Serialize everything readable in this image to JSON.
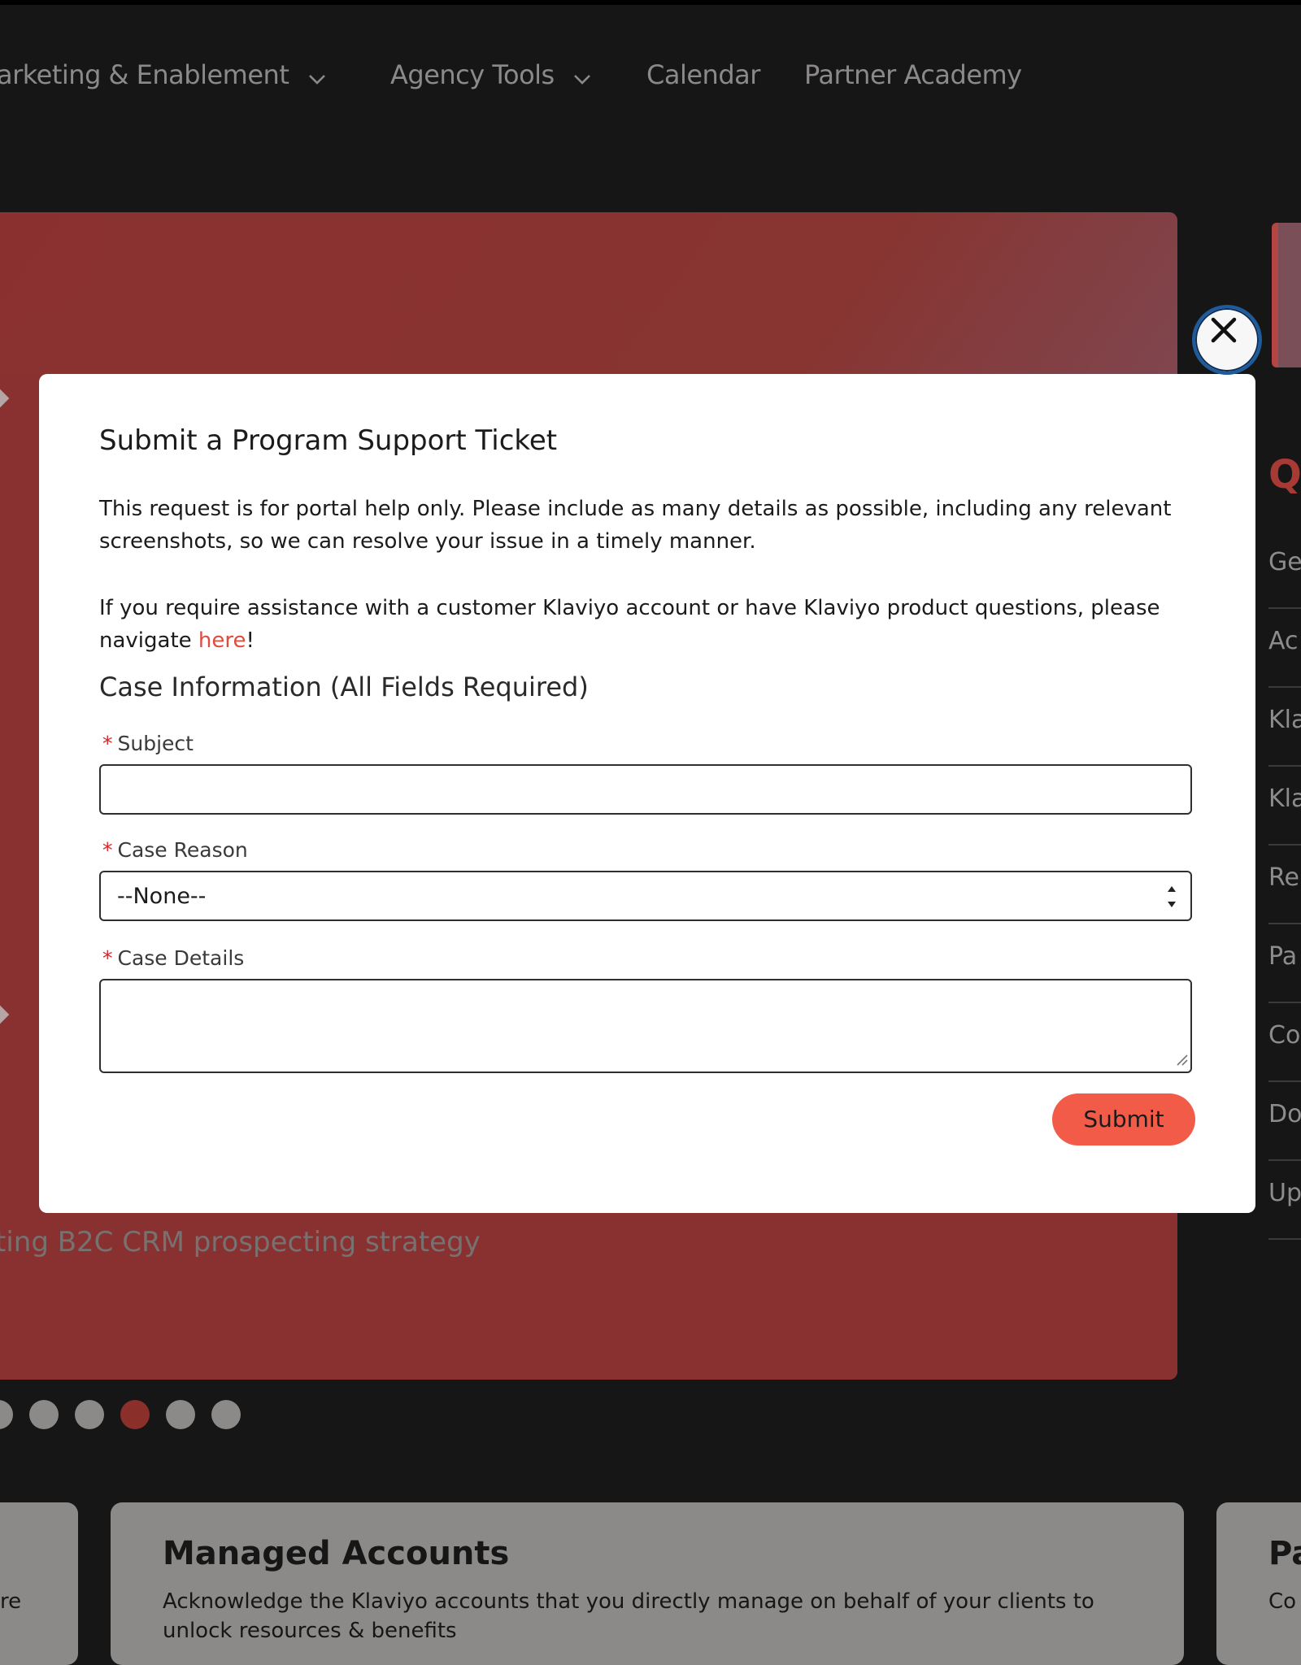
{
  "nav": {
    "items": [
      {
        "label": "arketing & Enablement",
        "has_dropdown": true
      },
      {
        "label": "Agency Tools",
        "has_dropdown": true
      },
      {
        "label": "Calendar",
        "has_dropdown": false
      },
      {
        "label": "Partner Academy",
        "has_dropdown": false
      }
    ]
  },
  "hero": {
    "caption": "ting B2C CRM prospecting strategy"
  },
  "carousel": {
    "dot_count": 6,
    "active_index": 3
  },
  "right_panel": {
    "heading_fragment": "Q",
    "items": [
      "Ge",
      "Ac",
      "Kla",
      "Kla",
      "Re",
      "Pa",
      "Co",
      "Do",
      "Up"
    ]
  },
  "cards": [
    {
      "title": "",
      "text": "re"
    },
    {
      "title": "Managed Accounts",
      "text": "Acknowledge the Klaviyo accounts that you directly manage on behalf of your clients to unlock resources & benefits"
    },
    {
      "title": "Pa",
      "text": "Co"
    }
  ],
  "modal": {
    "title": "Submit a Program Support Ticket",
    "para1": "This request is for portal help only. Please include as many details as possible, including any relevant screenshots, so we can resolve your issue in a timely manner.",
    "para2_prefix": "If you require assistance with a customer Klaviyo account or have Klaviyo product questions, please navigate ",
    "para2_link": "here",
    "para2_suffix": "!",
    "section_title": "Case Information (All Fields Required)",
    "subject_label": "Subject",
    "subject_value": "",
    "reason_label": "Case Reason",
    "reason_value": "--None--",
    "details_label": "Case Details",
    "details_value": "",
    "required_marker": "*",
    "submit_label": "Submit"
  },
  "colors": {
    "background": "#161616",
    "hero": "#893130",
    "accent": "#f25b48",
    "link": "#e04b3f",
    "required": "#d8252a",
    "close_border": "#1f5a9a"
  },
  "icons": [
    "chevron-down-icon",
    "close-icon",
    "select-arrows-icon",
    "resize-grip-icon"
  ]
}
